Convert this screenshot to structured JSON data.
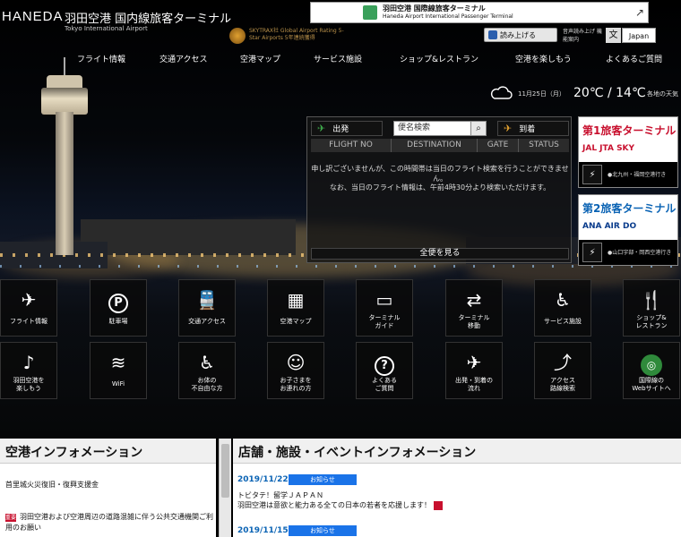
{
  "header": {
    "logo": "HANEDA",
    "title": "羽田空港 国内線旅客ターミナル",
    "subtitle": "Tokyo International Airport",
    "skytrax": "SKYTRAX社 Global Airport Rating 5-Star Airports 5年連続獲得",
    "intl_banner_jp": "羽田空港 国際線旅客ターミナル",
    "intl_banner_en": "Haneda Airport International Passenger Terminal",
    "read_aloud": "読み上げる",
    "lang_note": "音声読み上げ 機能案内",
    "lang": "Japan"
  },
  "nav": [
    "フライト情報",
    "交通アクセス",
    "空港マップ",
    "サービス施設",
    "ショップ&レストラン",
    "空港を楽しもう",
    "よくあるご質問"
  ],
  "weather": {
    "date": "11月25日（月）",
    "temp": "20℃ / 14℃",
    "link": "各地の天気"
  },
  "flight": {
    "departures": "出発",
    "arrivals": "到着",
    "search_placeholder": "便名検索",
    "columns": [
      "FLIGHT NO",
      "DESTINATION",
      "GATE",
      "STATUS"
    ],
    "message1": "申し訳ございませんが、この時間帯は当日のフライト検索を行うことができません。",
    "message2": "なお、当日のフライト情報は、午前4時30分より検索いただけます。",
    "all_flights": "全便を見る"
  },
  "terminals": [
    {
      "name": "第1旅客ターミナル",
      "airlines": "JAL  JTA  SKY",
      "dest": "●北九州・福岡空港行き"
    },
    {
      "name": "第2旅客ターミナル",
      "airlines": "ANA  AIR DO",
      "dest": "●山口宇部・岡西空港行き"
    }
  ],
  "tiles_row1": [
    {
      "icon": "✈",
      "label": "フライト情報"
    },
    {
      "icon": "P",
      "label": "駐車場"
    },
    {
      "icon": "🚆",
      "label": "交通アクセス"
    },
    {
      "icon": "▦",
      "label": "空港マップ"
    },
    {
      "icon": "▭",
      "label": "ターミナル\nガイド"
    },
    {
      "icon": "⇄",
      "label": "ターミナル\n移動"
    },
    {
      "icon": "♿",
      "label": "サービス施設"
    },
    {
      "icon": "🍴",
      "label": "ショップ&\nレストラン"
    }
  ],
  "tiles_row2": [
    {
      "icon": "♪",
      "label": "羽田空港を\n楽しもう"
    },
    {
      "icon": "≋",
      "label": "WiFi"
    },
    {
      "icon": "♿",
      "label": "お体の\n不自由な方"
    },
    {
      "icon": "☺",
      "label": "お子さまを\nお連れの方"
    },
    {
      "icon": "?",
      "label": "よくある\nご質問"
    },
    {
      "icon": "✈",
      "label": "出発・到着の\n流れ"
    },
    {
      "icon": "⤴",
      "label": "アクセス\n路線検索"
    },
    {
      "icon": "◎",
      "label": "国際線の\nWebサイトへ"
    }
  ],
  "info_left": {
    "title": "空港インフォメーション",
    "item1": "首里城火災復旧・復興支援金",
    "item2": "羽田空港および空港周辺の道路混雑に伴う公共交通機関ご利用のお願い",
    "badge": "重要"
  },
  "info_right": {
    "title": "店舗・施設・イベントインフォメーション",
    "events": [
      {
        "date": "2019/11/22",
        "tag": "お知らせ",
        "line1": "トビタテ！留学ＪＡＰＡＮ",
        "line2": "羽田空港は意欲と能力ある全ての日本の若者を応援します！"
      },
      {
        "date": "2019/11/15",
        "tag": "お知らせ"
      }
    ]
  }
}
